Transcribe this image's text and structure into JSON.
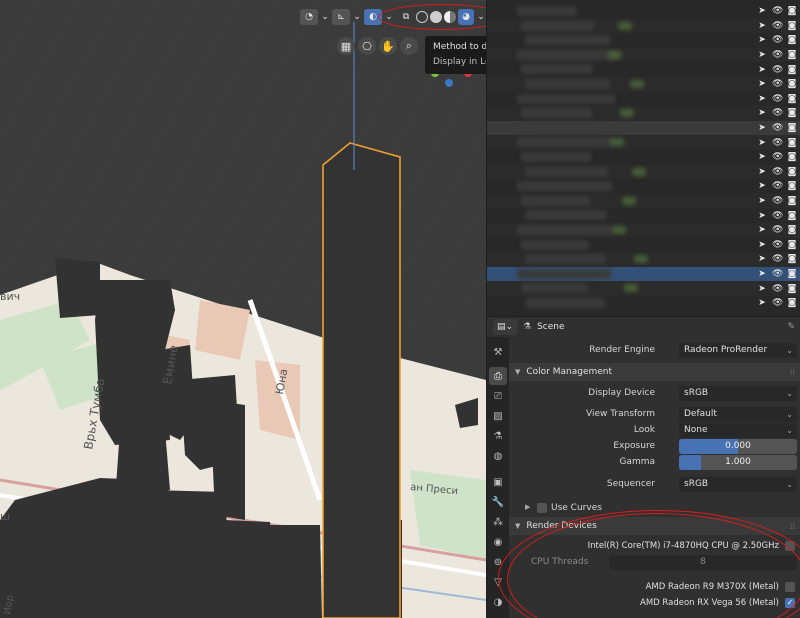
{
  "viewport": {
    "map_labels": [
      "вич",
      "Емине",
      "Врьх Тумба",
      "Юна",
      "ан Преси",
      "Иор",
      "ш"
    ],
    "tooltip": {
      "title": "Method to display/sha",
      "subtitle": "Display in LookDev m"
    },
    "header": {
      "dropdown_chevron": "⌄"
    }
  },
  "outliner": {
    "row_count": 21
  },
  "properties": {
    "header": {
      "context": "Scene"
    },
    "render_engine": {
      "label": "Render Engine",
      "value": "Radeon ProRender"
    },
    "color_management": {
      "title": "Color Management",
      "display_device": {
        "label": "Display Device",
        "value": "sRGB"
      },
      "view_transform": {
        "label": "View Transform",
        "value": "Default"
      },
      "look": {
        "label": "Look",
        "value": "None"
      },
      "exposure": {
        "label": "Exposure",
        "value": "0.000",
        "fill": 0.5
      },
      "gamma": {
        "label": "Gamma",
        "value": "1.000",
        "fill": 0.19
      },
      "sequencer": {
        "label": "Sequencer",
        "value": "sRGB"
      },
      "use_curves": {
        "label": "Use Curves",
        "checked": false
      }
    },
    "render_devices": {
      "title": "Render Devices",
      "cpu": {
        "label": "Intel(R) Core(TM) i7-4870HQ CPU @ 2.50GHz",
        "checked": false
      },
      "cpu_threads": {
        "label": "CPU Threads",
        "value": "8"
      },
      "gpu1": {
        "label": "AMD Radeon R9 M370X (Metal)",
        "checked": false
      },
      "gpu2": {
        "label": "AMD Radeon RX Vega 56 (Metal)",
        "checked": true
      }
    }
  },
  "colors": {
    "accent": "#4772b3",
    "selection_outline": "#f0a030",
    "annotation": "#d61c1c"
  }
}
